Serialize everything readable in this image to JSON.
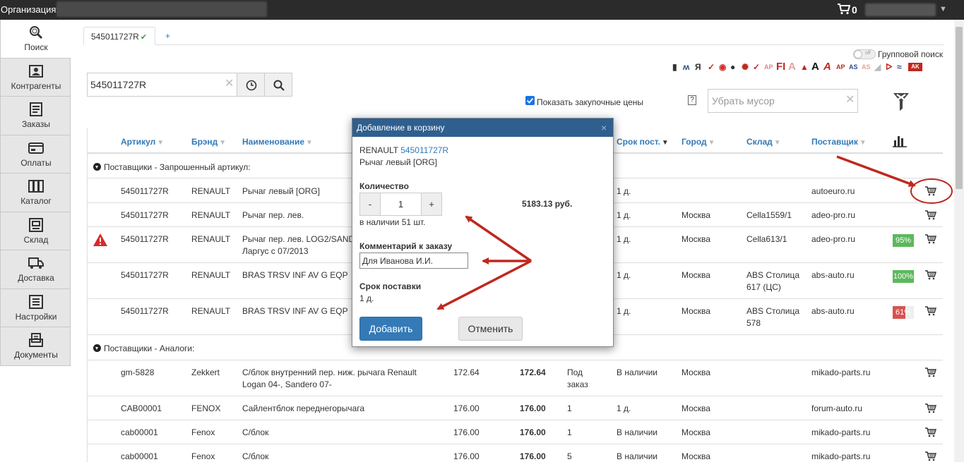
{
  "topbar": {
    "org_label": "Организация:",
    "cart_count": "0"
  },
  "sidebar": {
    "items": [
      {
        "label": "Поиск",
        "icon": "search-icon"
      },
      {
        "label": "Контрагенты",
        "icon": "contacts-icon"
      },
      {
        "label": "Заказы",
        "icon": "orders-icon"
      },
      {
        "label": "Оплаты",
        "icon": "payments-icon"
      },
      {
        "label": "Каталог",
        "icon": "catalog-icon"
      },
      {
        "label": "Склад",
        "icon": "warehouse-icon"
      },
      {
        "label": "Доставка",
        "icon": "delivery-icon"
      },
      {
        "label": "Настройки",
        "icon": "settings-icon"
      },
      {
        "label": "Документы",
        "icon": "documents-icon"
      }
    ]
  },
  "tabs": {
    "active": "545011727R",
    "add": "+"
  },
  "search": {
    "value": "545011727R"
  },
  "controls": {
    "group_search_label": "Групповой поиск",
    "toggle_state": "off",
    "show_purchase_prices": "Показать закупочные цены",
    "help": "?",
    "trash_placeholder": "Убрать мусор"
  },
  "table": {
    "headers": [
      "Артикул",
      "Брэнд",
      "Наименование",
      "Срок пост.",
      "Город",
      "Склад",
      "Поставщик"
    ],
    "group_requested": "Поставщики - Запрошенный артикул:",
    "group_analogs": "Поставщики - Аналоги:",
    "requested_rows": [
      {
        "article": "545011727R",
        "brand": "RENAULT",
        "name": "Рычаг левый [ORG]",
        "term": "1 д.",
        "city": "",
        "warehouse": "",
        "supplier": "autoeuro.ru",
        "pct": ""
      },
      {
        "article": "545011727R",
        "brand": "RENAULT",
        "name": "Рычаг пер. лев.",
        "term": "1 д.",
        "city": "Москва",
        "warehouse": "Cella1559/1",
        "supplier": "adeo-pro.ru",
        "pct": ""
      },
      {
        "article": "545011727R",
        "brand": "RENAULT",
        "name": "Рычаг пер. лев. LOG2/SAND",
        "name2": "Ларгус с 07/2013",
        "term": "1 д.",
        "city": "Москва",
        "warehouse": "Cella613/1",
        "supplier": "adeo-pro.ru",
        "pct": "95%"
      },
      {
        "article": "545011727R",
        "brand": "RENAULT",
        "name": "BRAS TRSV INF AV G EQP",
        "term": "1 д.",
        "city": "Москва",
        "warehouse": "ABS Столица",
        "warehouse2": "617 (ЦС)",
        "supplier": "abs-auto.ru",
        "pct": "100%"
      },
      {
        "article": "545011727R",
        "brand": "RENAULT",
        "name": "BRAS TRSV INF AV G EQP",
        "term": "1 д.",
        "city": "Москва",
        "warehouse": "ABS Столица",
        "warehouse2": "578",
        "supplier": "abs-auto.ru",
        "pct": "61%"
      }
    ],
    "analog_rows": [
      {
        "article": "gm-5828",
        "brand": "Zekkert",
        "name": "С/блок внутренний пер. ниж. рычага Renault",
        "name2": "Logan 04-, Sandero 07-",
        "price": "172.64",
        "price_bold": "172.64",
        "qty": "Под",
        "qty2": "заказ",
        "term": "В наличии",
        "city": "Москва",
        "supplier": "mikado-parts.ru"
      },
      {
        "article": "CAB00001",
        "brand": "FENOX",
        "name": "Сайлентблок переднегорычага",
        "price": "176.00",
        "price_bold": "176.00",
        "qty": "1",
        "term": "1 д.",
        "city": "Москва",
        "supplier": "forum-auto.ru"
      },
      {
        "article": "cab00001",
        "brand": "Fenox",
        "name": "С/блок",
        "price": "176.00",
        "price_bold": "176.00",
        "qty": "1",
        "term": "В наличии",
        "city": "Москва",
        "supplier": "mikado-parts.ru"
      },
      {
        "article": "cab00001",
        "brand": "Fenox",
        "name": "С/блок",
        "price": "176.00",
        "price_bold": "176.00",
        "qty": "5",
        "term": "В наличии",
        "city": "Москва",
        "supplier": "mikado-parts.ru"
      }
    ],
    "pct_fill": {
      "row3": 0.95,
      "row4": 1.0,
      "row5": 0.61
    }
  },
  "modal": {
    "title": "Добавление в корзину",
    "brand": "RENAULT",
    "article": "545011727R",
    "product": "Рычаг левый [ORG]",
    "qty_label": "Количество",
    "qty_minus": "-",
    "qty_value": "1",
    "qty_plus": "+",
    "price": "5183.13 руб.",
    "availability": "в наличии 51 шт.",
    "comment_label": "Комментарий к заказу",
    "comment_value": "Для Иванова И.И.",
    "delivery_label": "Срок поставки",
    "delivery_value": "1 д.",
    "add_button": "Добавить",
    "cancel_button": "Отменить",
    "close": "×"
  },
  "colors": {
    "accent": "#337ab7",
    "header_bar": "#2f5f8f",
    "green": "#5cb85c",
    "red": "#d9534f",
    "annotation": "#c0281e"
  }
}
